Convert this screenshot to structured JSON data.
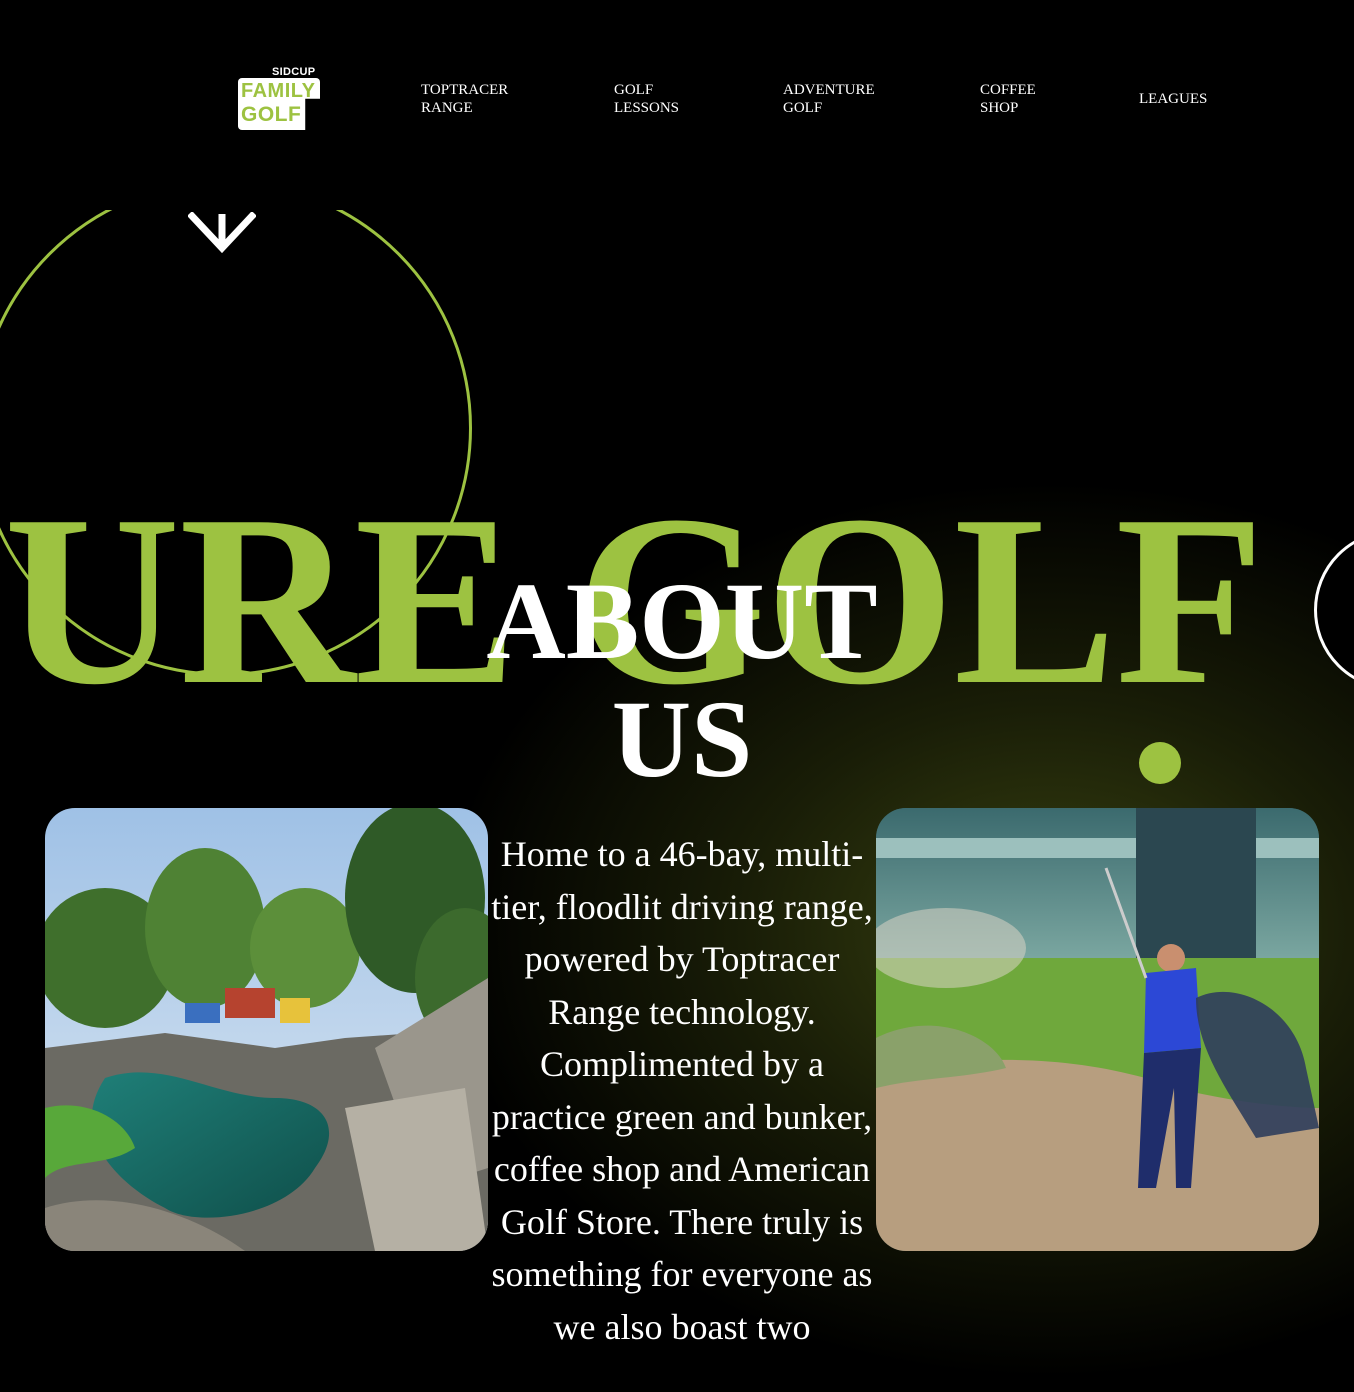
{
  "brand": {
    "logo_top": "SIDCUP",
    "logo_line1": "FAMILY",
    "logo_line2": "GOLF",
    "accent_color": "#9dc241"
  },
  "nav": {
    "items": [
      {
        "label": "TOPTRACER\nRANGE"
      },
      {
        "label": "GOLF\nLESSONS"
      },
      {
        "label": "ADVENTURE\nGOLF"
      },
      {
        "label": "COFFEE\nSHOP"
      },
      {
        "label": "LEAGUES"
      }
    ]
  },
  "hero": {
    "scroll_icon": "chevron-down-icon",
    "marquee_text": "URE GOLF",
    "about_title": "ABOUT\nUS",
    "about_paragraph": "Home to a 46-bay, multi-tier, floodlit driving range, powered by Toptracer Range technology. Complimented by a practice green and bunker, coffee shop and American Golf Store. There truly is something for everyone as we also boast two"
  },
  "photos": {
    "left_icon": "adventure-golf-photo",
    "right_icon": "golfer-bunker-photo"
  }
}
